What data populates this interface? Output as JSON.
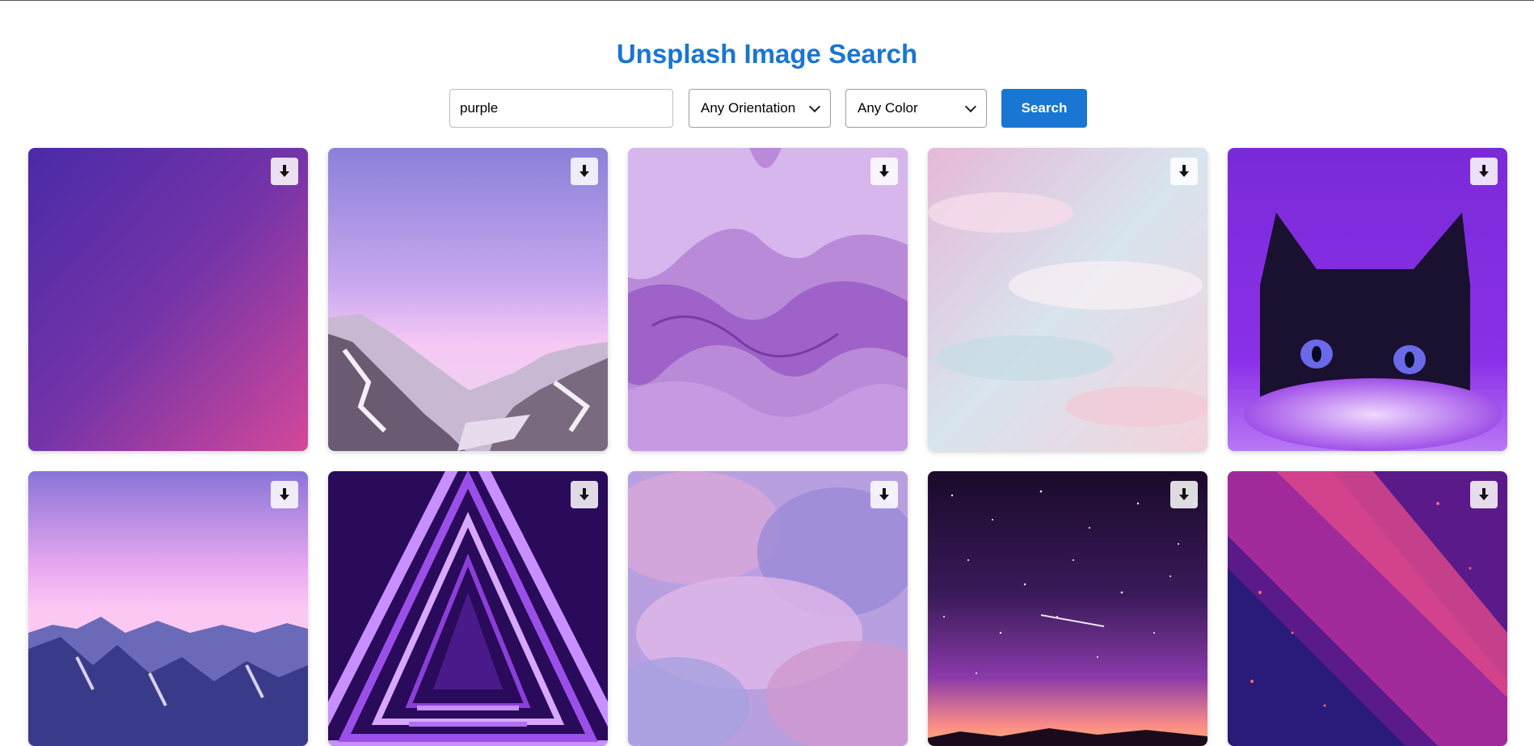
{
  "header": {
    "title": "Unsplash Image Search"
  },
  "search": {
    "value": "purple"
  },
  "filters": {
    "orientation": {
      "selected": "Any Orientation"
    },
    "color": {
      "selected": "Any Color"
    }
  },
  "actions": {
    "search_label": "Search"
  },
  "results": [
    {
      "subject": "purple-pink gradient"
    },
    {
      "subject": "snowy mountains under lavender sky"
    },
    {
      "subject": "purple silk fabric"
    },
    {
      "subject": "pastel pink clouds"
    },
    {
      "subject": "cat in purple light"
    },
    {
      "subject": "mountain range at pink dusk"
    },
    {
      "subject": "neon triangle tunnel"
    },
    {
      "subject": "purple watercolor texture"
    },
    {
      "subject": "starry night sky with shooting star"
    },
    {
      "subject": "red and purple light rays"
    }
  ],
  "colors": {
    "accent": "#1976d2"
  },
  "icons": {
    "download": "download-arrow-icon"
  }
}
